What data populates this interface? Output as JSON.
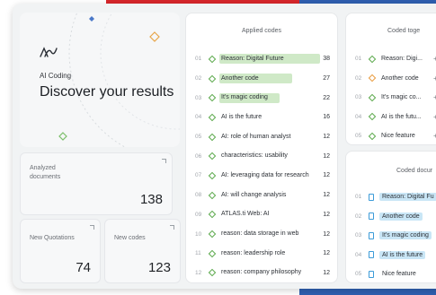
{
  "hero": {
    "subtitle": "AI Coding",
    "title": "Discover your results"
  },
  "stats": {
    "documents": {
      "label": "Analyzed documents",
      "value": "138"
    },
    "quotations": {
      "label": "New Quotations",
      "value": "74"
    },
    "codes": {
      "label": "New codes",
      "value": "123"
    }
  },
  "applied": {
    "title": "Applied codes",
    "rows": [
      {
        "idx": "01",
        "label": "Reason: Digital Future",
        "count": "38",
        "share": 1.0
      },
      {
        "idx": "02",
        "label": "Another code",
        "count": "27",
        "share": 0.72
      },
      {
        "idx": "03",
        "label": "It's magic coding",
        "count": "22",
        "share": 0.6
      },
      {
        "idx": "04",
        "label": "AI is the future",
        "count": "16",
        "share": 0
      },
      {
        "idx": "05",
        "label": "AI: role of human analyst",
        "count": "12",
        "share": 0
      },
      {
        "idx": "06",
        "label": "characteristics: usability",
        "count": "12",
        "share": 0
      },
      {
        "idx": "07",
        "label": "AI: leveraging data for research",
        "count": "12",
        "share": 0
      },
      {
        "idx": "08",
        "label": "AI: will change analysis",
        "count": "12",
        "share": 0
      },
      {
        "idx": "09",
        "label": "ATLAS.ti Web: AI",
        "count": "12",
        "share": 0
      },
      {
        "idx": "10",
        "label": "reason: data storage in web",
        "count": "12",
        "share": 0
      },
      {
        "idx": "11",
        "label": "reason: leadership role",
        "count": "12",
        "share": 0
      },
      {
        "idx": "12",
        "label": "reason: company philosophy",
        "count": "12",
        "share": 0
      }
    ]
  },
  "together": {
    "title": "Coded toge",
    "rows": [
      {
        "idx": "01",
        "label": "Reason: Digi...",
        "plus": "+"
      },
      {
        "idx": "02",
        "label": "Another code",
        "plus": "+"
      },
      {
        "idx": "03",
        "label": "It's magic co...",
        "plus": "+"
      },
      {
        "idx": "04",
        "label": "AI is the futu...",
        "plus": "+"
      },
      {
        "idx": "05",
        "label": "Nice feature",
        "plus": "+"
      }
    ]
  },
  "documents": {
    "title": "Coded docur",
    "rows": [
      {
        "idx": "01",
        "label": "Reason: Digital Fu",
        "highlight": true
      },
      {
        "idx": "02",
        "label": "Another code",
        "highlight": true
      },
      {
        "idx": "03",
        "label": "It's magic coding",
        "highlight": true
      },
      {
        "idx": "04",
        "label": "AI is the future",
        "highlight": true
      },
      {
        "idx": "05",
        "label": "Nice feature",
        "highlight": false
      }
    ]
  },
  "colors": {
    "accent_red": "#d7262b",
    "accent_blue": "#2f5fb0",
    "code_green": "#5aa84a",
    "bar_green": "#cfe9c7",
    "doc_blue": "#3b9bd8",
    "highlight_blue": "#c9e6f6",
    "orange": "#e89a3c"
  }
}
